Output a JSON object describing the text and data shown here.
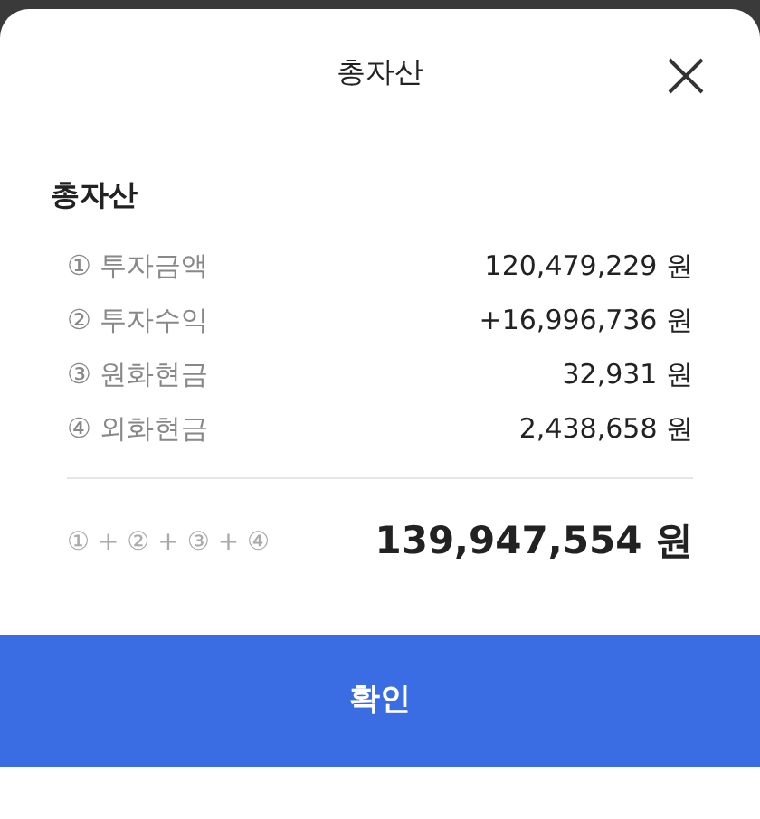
{
  "header": {
    "title": "총자산"
  },
  "section": {
    "heading": "총자산"
  },
  "rows": [
    {
      "label": "① 투자금액",
      "value": "120,479,229 원"
    },
    {
      "label": "② 투자수익",
      "value": "+16,996,736 원"
    },
    {
      "label": "③ 원화현금",
      "value": "32,931 원"
    },
    {
      "label": "④ 외화현금",
      "value": "2,438,658 원"
    }
  ],
  "total": {
    "formula": "① + ② + ③ + ④",
    "value": "139,947,554 원"
  },
  "button": {
    "label": "확인"
  }
}
